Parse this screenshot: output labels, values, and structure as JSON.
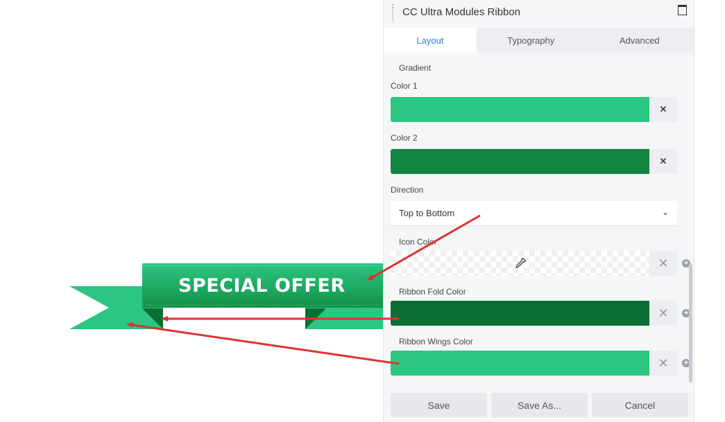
{
  "preview": {
    "ribbon_text": "SPECIAL OFFER",
    "colors": {
      "main_top": "#2dc683",
      "main_bottom": "#119146",
      "fold": "#0b6e34",
      "wings": "#2bc681",
      "arrow": "#e03131"
    }
  },
  "panel": {
    "title": "CC Ultra Modules Ribbon",
    "tabs": [
      {
        "label": "Layout",
        "active": true
      },
      {
        "label": "Typography",
        "active": false
      },
      {
        "label": "Advanced",
        "active": false
      }
    ],
    "gradient": {
      "section_label": "Gradient",
      "color1_label": "Color 1",
      "color1_value": "#2bc681",
      "color2_label": "Color 2",
      "color2_value": "#128541",
      "direction_label": "Direction",
      "direction_value": "Top to Bottom"
    },
    "icon_color_label": "Icon Color",
    "fold_color_label": "Ribbon Fold Color",
    "fold_color_value": "#0b6e34",
    "wings_color_label": "Ribbon Wings Color",
    "wings_color_value": "#2bc681",
    "footer": {
      "save": "Save",
      "save_as": "Save As...",
      "cancel": "Cancel"
    }
  }
}
